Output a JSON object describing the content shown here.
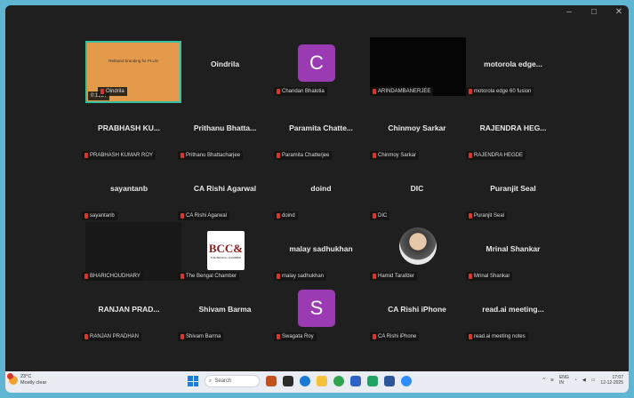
{
  "window": {
    "controls": [
      "–",
      "□",
      "✕"
    ]
  },
  "shared_screen": {
    "caption": "Rebrand branding for PLUS",
    "timer": "0:1227"
  },
  "tiles": [
    {
      "id": "t1",
      "center_name": "",
      "label": "Oindrila"
    },
    {
      "id": "t2",
      "center_name": "Oindrila",
      "label": ""
    },
    {
      "id": "t3",
      "center_name": "",
      "label": "Chandan Bhalotia",
      "avatar_letter": "C",
      "avatar_color": "#9b3bb4"
    },
    {
      "id": "t4",
      "center_name": "",
      "label": "ARINDAMBANERJEE"
    },
    {
      "id": "t5",
      "center_name": "motorola edge...",
      "label": "motorola edge 60 fusion"
    },
    {
      "id": "t6",
      "center_name": "PRABHASH KU...",
      "label": "PRABHASH KUMAR ROY"
    },
    {
      "id": "t7",
      "center_name": "Prithanu Bhatta...",
      "label": "Prithanu Bhattacharjee"
    },
    {
      "id": "t8",
      "center_name": "Paramita Chatte...",
      "label": "Paramita Chatterjee"
    },
    {
      "id": "t9",
      "center_name": "Chinmoy Sarkar",
      "label": "Chinmoy Sarkar"
    },
    {
      "id": "t10",
      "center_name": "RAJENDRA HEG...",
      "label": "RAJENDRA HEGDE"
    },
    {
      "id": "t11",
      "center_name": "sayantanb",
      "label": "sayantanb"
    },
    {
      "id": "t12",
      "center_name": "CA Rishi Agarwal",
      "label": "CA Rishi Agarwal"
    },
    {
      "id": "t13",
      "center_name": "doind",
      "label": "doind"
    },
    {
      "id": "t14",
      "center_name": "DIC",
      "label": "DIC"
    },
    {
      "id": "t15",
      "center_name": "Puranjit Seal",
      "label": "Puranjit Seal"
    },
    {
      "id": "t16",
      "center_name": "",
      "label": "BHARICHOUDHARY"
    },
    {
      "id": "t17",
      "center_name": "",
      "label": "The Bengal Chamber"
    },
    {
      "id": "t18",
      "center_name": "malay sadhukhan",
      "label": "malay sadhukhan"
    },
    {
      "id": "t19",
      "center_name": "",
      "label": "Hamid Tarafder"
    },
    {
      "id": "t20",
      "center_name": "Mrinal Shankar",
      "label": "Mrinal Shankar"
    },
    {
      "id": "t21",
      "center_name": "RANJAN PRAD...",
      "label": "RANJAN PRADHAN"
    },
    {
      "id": "t22",
      "center_name": "Shivam Barma",
      "label": "Shivam Barma"
    },
    {
      "id": "t23",
      "center_name": "",
      "label": "Swagata Roy",
      "avatar_letter": "S",
      "avatar_color": "#9b3bb4"
    },
    {
      "id": "t24",
      "center_name": "CA Rishi iPhone",
      "label": "CA Rishi iPhone"
    },
    {
      "id": "t25",
      "center_name": "read.ai meeting...",
      "label": "read.ai meeting notes"
    }
  ],
  "bcc_logo": {
    "text": "BCC&",
    "subtext": "THE BENGAL CHAMBER"
  },
  "taskbar": {
    "weather_temp": "23°C",
    "weather_desc": "Mostly clear",
    "search_placeholder": "Search",
    "lang": "ENG",
    "region": "IN",
    "time": "17:07",
    "date": "12-12-2025"
  }
}
